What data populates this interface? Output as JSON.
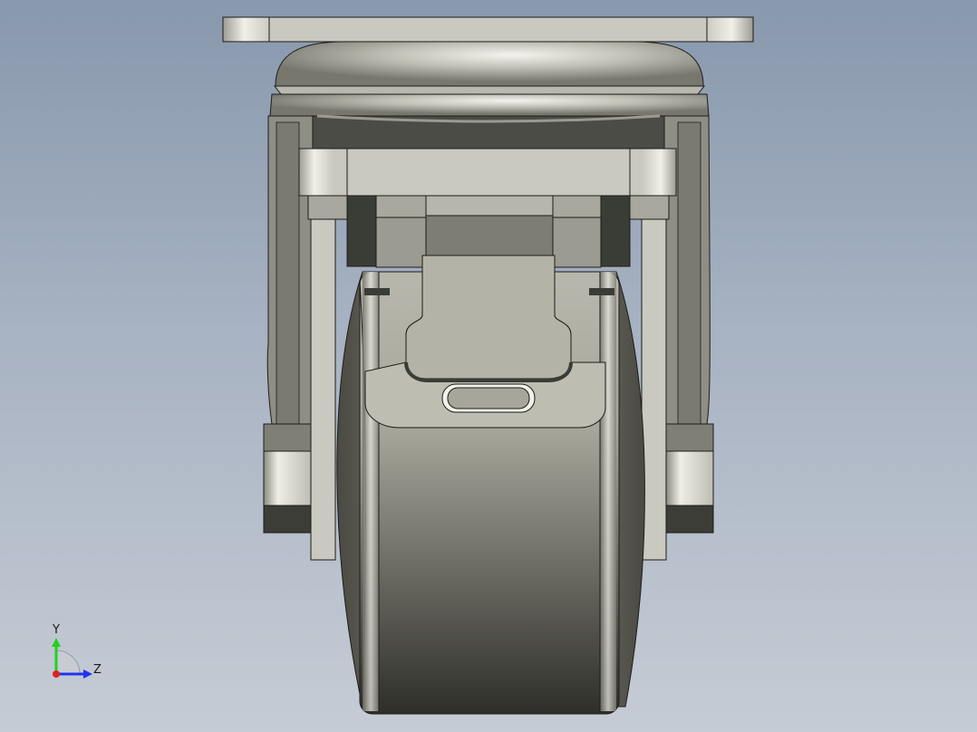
{
  "viewport": {
    "background_top": "#8898ad",
    "background_bottom": "#c6ccd5"
  },
  "model": {
    "subject": "swivel-caster-with-brake",
    "shade_dark": "#3a3d36",
    "shade_mid": "#8d8d83",
    "shade_light": "#d8d8cf",
    "edge_color": "#1c1c1a"
  },
  "triad": {
    "y_label": "Y",
    "z_label": "Z",
    "y_color": "#1fd11f",
    "z_color": "#2233ee",
    "x_color": "#dd2222"
  }
}
